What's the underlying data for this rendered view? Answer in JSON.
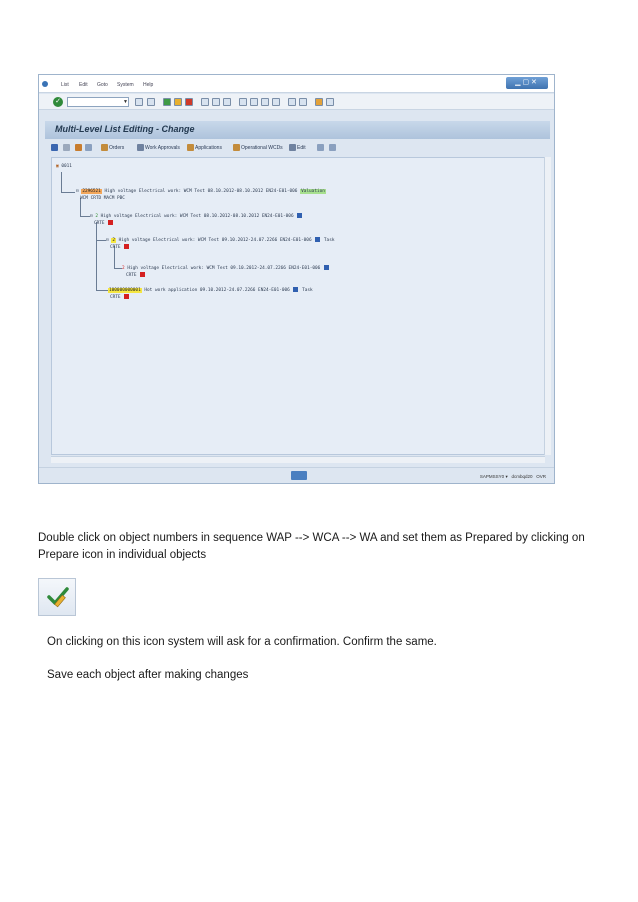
{
  "sap_window": {
    "menu": [
      "List",
      "Edit",
      "Goto",
      "System",
      "Help"
    ],
    "title": "Multi-Level List Editing - Change",
    "app_toolbar": [
      "Orders",
      "Work Approvals",
      "Applications",
      "Operational WCDs",
      "Edit"
    ],
    "tree": {
      "root": "0011",
      "n1_id": "2296521",
      "n1_text": "High voltage Electrical work: WCM Test 08.10.2012-08.10.2012 EN24-E01-006",
      "n1_tag": "Valuation",
      "n1_status": "WCM  CRTD MACM PBC",
      "n2_id": "2",
      "n2_text": "High voltage Electrical work: WCM Test 08.10.2012-08.10.2012 EN24-E01-006",
      "n2_status": "CRTE",
      "n3_id": "2",
      "n3_text": "High voltage Electrical work: WCM Test 09.10.2012-24.07.2266 EN24-E01-006",
      "n3_tag": "Task",
      "n3_status": "CRTE",
      "n4_id": "2",
      "n4_text": "High voltage Electrical work: WCM Test 09.10.2012-24.07.2266 EN24-E01-006",
      "n4_status": "CRTE",
      "n5_id": "100000000001",
      "n5_text": "Hot work application 09.10.2012-24.07.2266 EN24-E01-006",
      "n5_tag": "Task",
      "n5_status": "CRTE"
    },
    "status": {
      "system": "SAPMSSY0",
      "server": "dcmbqd20",
      "mode": "OVR"
    }
  },
  "doc": {
    "para1": "Double click on object numbers in sequence WAP --> WCA --> WA and set them as Prepared by clicking on Prepare icon in individual objects",
    "para2": "On clicking on this icon system will ask for a confirmation. Confirm the same.",
    "para3": "Save each object after making changes"
  },
  "colors": {
    "orange_highlight": "#f2a65a",
    "yellow_highlight": "#f5e642",
    "green_highlight": "#a7e08f",
    "status_red": "#d42020"
  }
}
